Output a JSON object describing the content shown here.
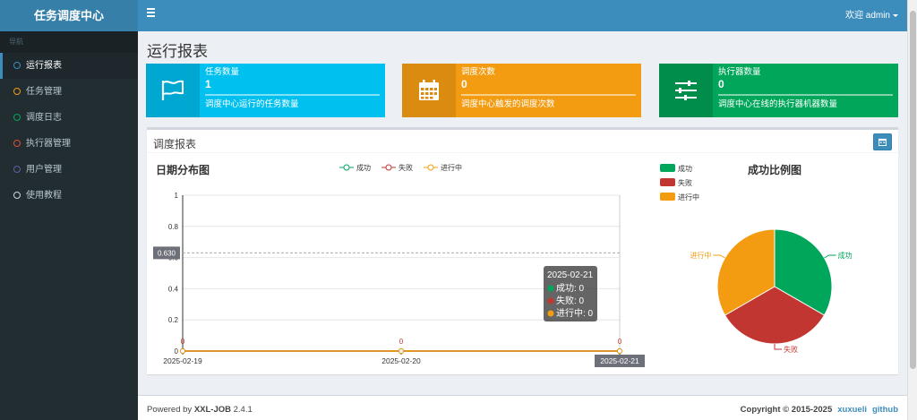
{
  "app": {
    "logo": "任务调度中心"
  },
  "header": {
    "user": "欢迎 admin"
  },
  "sidebar": {
    "header": "导航",
    "items": [
      {
        "label": "运行报表",
        "color": "#3c8dbc"
      },
      {
        "label": "任务管理",
        "color": "#f39c12"
      },
      {
        "label": "调度日志",
        "color": "#00a65a"
      },
      {
        "label": "执行器管理",
        "color": "#dd4b39"
      },
      {
        "label": "用户管理",
        "color": "#605ca8"
      },
      {
        "label": "使用教程",
        "color": "#d2d6de"
      }
    ]
  },
  "page": {
    "title": "运行报表"
  },
  "cards": [
    {
      "label": "任务数量",
      "value": "1",
      "desc": "调度中心运行的任务数量",
      "color": "#00c0ef",
      "icon_bg": "#00a7d0",
      "icon": "flag-icon"
    },
    {
      "label": "调度次数",
      "value": "0",
      "desc": "调度中心触发的调度次数",
      "color": "#f39c12",
      "icon_bg": "#da8c10",
      "icon": "calendar-icon"
    },
    {
      "label": "执行器数量",
      "value": "0",
      "desc": "调度中心在线的执行器机器数量",
      "color": "#00a65a",
      "icon_bg": "#008d4c",
      "icon": "sliders-icon"
    }
  ],
  "report": {
    "title": "调度报表",
    "line_title": "日期分布图",
    "pie_title": "成功比例图"
  },
  "chart_data": [
    {
      "type": "line",
      "title": "日期分布图",
      "x": [
        "2025-02-19",
        "2025-02-20",
        "2025-02-21"
      ],
      "yticks": [
        "0",
        "0.2",
        "0.4",
        "0.6",
        "0.8",
        "1"
      ],
      "ylim": [
        0,
        1
      ],
      "series": [
        {
          "name": "成功",
          "color": "#00a65a",
          "values": [
            0,
            0,
            0
          ]
        },
        {
          "name": "失败",
          "color": "#c23632",
          "values": [
            0,
            0,
            0
          ]
        },
        {
          "name": "进行中",
          "color": "#f39c12",
          "values": [
            0,
            0,
            0
          ]
        }
      ],
      "data_label": "0",
      "axis_pointer_label": "0.630",
      "axis_pointer_value": 0.63,
      "tooltip": {
        "title": "2025-02-21",
        "rows": [
          "成功: 0",
          "失败: 0",
          "进行中: 0"
        ]
      },
      "x_pointer_label": "2025-02-21"
    },
    {
      "type": "pie",
      "title": "成功比例图",
      "slices": [
        {
          "name": "成功",
          "value": 1,
          "color": "#00a65a"
        },
        {
          "name": "失败",
          "value": 1,
          "color": "#c23632"
        },
        {
          "name": "进行中",
          "value": 1,
          "color": "#f39c12"
        }
      ]
    }
  ],
  "footer": {
    "powered_prefix": "Powered by ",
    "powered_name": "XXL-JOB",
    "version": " 2.4.1",
    "copyright": "Copyright © 2015-2025",
    "link1": "xuxueli",
    "link2": "github"
  }
}
